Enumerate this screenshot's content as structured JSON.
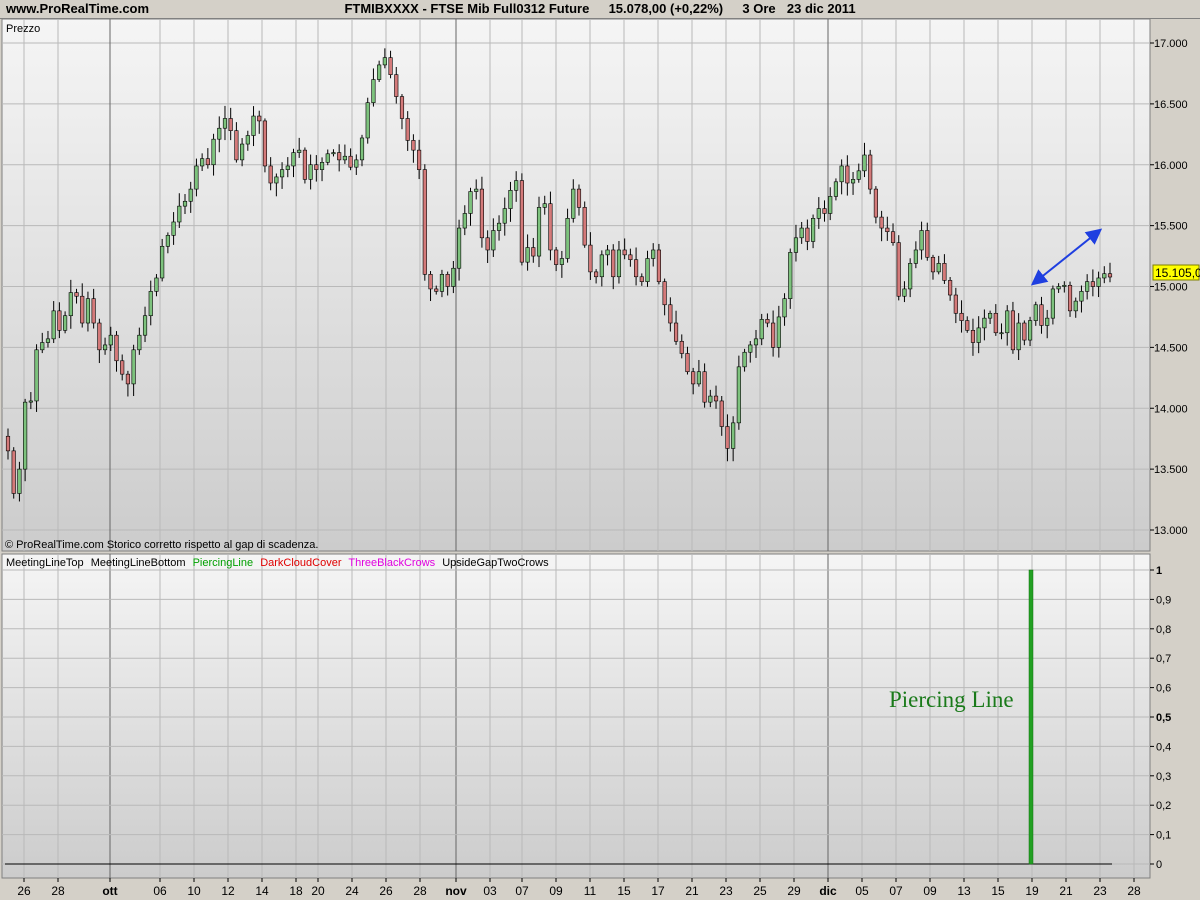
{
  "header": {
    "site": "www.ProRealTime.com",
    "title": "FTMIBXXXX - FTSE Mib Full0312 Future",
    "quote": "15.078,00 (+0,22%)",
    "timeframe": "3 Ore",
    "date": "23 dic 2011"
  },
  "price_panel": {
    "label": "Prezzo",
    "footnote": "© ProRealTime.com  Storico corretto rispetto al gap di scadenza.",
    "last_price_tag": "15.105,0"
  },
  "indicator_panel": {
    "legend": [
      {
        "text": "MeetingLineTop",
        "color": "#000000"
      },
      {
        "text": "MeetingLineBottom",
        "color": "#000000"
      },
      {
        "text": "PiercingLine",
        "color": "#00a000"
      },
      {
        "text": "DarkCloudCover",
        "color": "#e00000"
      },
      {
        "text": "ThreeBlackCrows",
        "color": "#e000e0"
      },
      {
        "text": "UpsideGapTwoCrows",
        "color": "#000000"
      }
    ],
    "annotation": "Piercing Line"
  },
  "colors": {
    "up_candle": "#7dc27d",
    "down_candle": "#d47a7a",
    "arrow": "#1f3fe0",
    "signal_bar": "#22a022",
    "panel_bg_top": "#f4f4f4",
    "panel_bg_bottom": "#cdcdcd"
  },
  "chart_data": [
    {
      "type": "candlestick",
      "title": "FTMIBXXXX - FTSE Mib Full0312 Future",
      "ylabel": "Prezzo",
      "ylim": [
        12850,
        17050
      ],
      "y_ticks": [
        {
          "v": 13000,
          "label": "13.000"
        },
        {
          "v": 13500,
          "label": "13.500"
        },
        {
          "v": 14000,
          "label": "14.000"
        },
        {
          "v": 14500,
          "label": "14.500"
        },
        {
          "v": 15000,
          "label": "15.000"
        },
        {
          "v": 15500,
          "label": "15.500"
        },
        {
          "v": 16000,
          "label": "16.000"
        },
        {
          "v": 16500,
          "label": "16.500"
        },
        {
          "v": 17000,
          "label": "17.000"
        }
      ],
      "x_ticks": [
        {
          "label": "26"
        },
        {
          "label": "28"
        },
        {
          "label": "ott",
          "bold": true
        },
        {
          "label": "06"
        },
        {
          "label": "10"
        },
        {
          "label": "12"
        },
        {
          "label": "14"
        },
        {
          "label": "18"
        },
        {
          "label": "20"
        },
        {
          "label": "24"
        },
        {
          "label": "26"
        },
        {
          "label": "28"
        },
        {
          "label": "nov",
          "bold": true
        },
        {
          "label": "03"
        },
        {
          "label": "07"
        },
        {
          "label": "09"
        },
        {
          "label": "11"
        },
        {
          "label": "15"
        },
        {
          "label": "17"
        },
        {
          "label": "21"
        },
        {
          "label": "23"
        },
        {
          "label": "25"
        },
        {
          "label": "29"
        },
        {
          "label": "dic",
          "bold": true
        },
        {
          "label": "05"
        },
        {
          "label": "07"
        },
        {
          "label": "09"
        },
        {
          "label": "13"
        },
        {
          "label": "15"
        },
        {
          "label": "19"
        },
        {
          "label": "21"
        },
        {
          "label": "23"
        },
        {
          "label": "28"
        }
      ],
      "closes": [
        13650,
        13300,
        13500,
        14050,
        14060,
        14480,
        14540,
        14570,
        14800,
        14640,
        14760,
        14950,
        14920,
        14700,
        14900,
        14700,
        14480,
        14520,
        14600,
        14390,
        14280,
        14200,
        14480,
        14600,
        14760,
        14960,
        15070,
        15330,
        15420,
        15530,
        15660,
        15700,
        15800,
        15990,
        16050,
        16000,
        16210,
        16300,
        16380,
        16280,
        16040,
        16170,
        16240,
        16400,
        16360,
        15990,
        15850,
        15900,
        15960,
        15990,
        16100,
        16120,
        15880,
        16000,
        15960,
        16020,
        16090,
        16100,
        16040,
        16070,
        15980,
        16040,
        16220,
        16510,
        16700,
        16820,
        16880,
        16740,
        16560,
        16380,
        16200,
        16120,
        15960,
        15100,
        14980,
        14960,
        15100,
        15000,
        15150,
        15480,
        15600,
        15780,
        15800,
        15400,
        15300,
        15460,
        15520,
        15640,
        15790,
        15870,
        15200,
        15320,
        15250,
        15650,
        15680,
        15300,
        15180,
        15230,
        15560,
        15800,
        15650,
        15340,
        15120,
        15080,
        15260,
        15300,
        15080,
        15300,
        15260,
        15220,
        15080,
        15040,
        15230,
        15300,
        15040,
        14850,
        14700,
        14550,
        14450,
        14300,
        14200,
        14300,
        14050,
        14100,
        14060,
        13850,
        13670,
        13880,
        14340,
        14460,
        14520,
        14570,
        14730,
        14700,
        14500,
        14750,
        14900,
        15280,
        15400,
        15480,
        15370,
        15560,
        15640,
        15600,
        15740,
        15860,
        15990,
        15850,
        15880,
        15950,
        16080,
        15800,
        15570,
        15480,
        15450,
        15360,
        14920,
        14980,
        15190,
        15300,
        15460,
        15240,
        15120,
        15190,
        15050,
        14930,
        14780,
        14720,
        14640,
        14540,
        14660,
        14740,
        14780,
        14620,
        14620,
        14800,
        14480,
        14700,
        14560,
        14720,
        14850,
        14680,
        14740,
        14980,
        15000,
        15010,
        14800,
        14880,
        14960,
        15040,
        15000,
        15070,
        15105,
        15078
      ],
      "last": 15078,
      "note": "Closes of the 3-hour candles, read approximately from the chart"
    },
    {
      "type": "bar",
      "title": "MeetingLineTop MeetingLineBottom PiercingLine DarkCloudCover ThreeBlackCrows UpsideGapTwoCrows",
      "ylim": [
        0,
        1
      ],
      "y_ticks": [
        {
          "v": 1,
          "label": "1",
          "bold": true
        },
        {
          "v": 0.9,
          "label": "0,9"
        },
        {
          "v": 0.8,
          "label": "0,8"
        },
        {
          "v": 0.7,
          "label": "0,7"
        },
        {
          "v": 0.6,
          "label": "0,6"
        },
        {
          "v": 0.5,
          "label": "0,5",
          "bold": true
        },
        {
          "v": 0.4,
          "label": "0,4"
        },
        {
          "v": 0.3,
          "label": "0,3"
        },
        {
          "v": 0.2,
          "label": "0,2"
        },
        {
          "v": 0.1,
          "label": "0,1"
        },
        {
          "v": 0,
          "label": "0"
        }
      ],
      "signals": [
        {
          "series": "PiercingLine",
          "date": "19",
          "value": 1
        }
      ]
    }
  ]
}
